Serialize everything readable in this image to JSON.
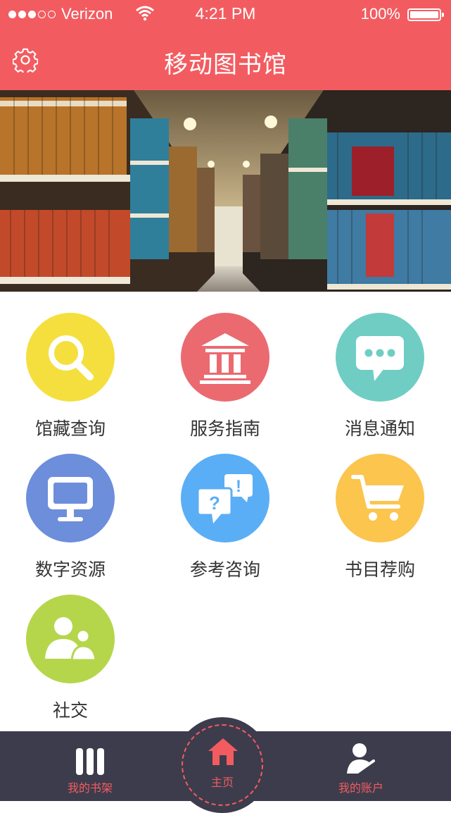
{
  "status_bar": {
    "carrier": "Verizon",
    "time": "4:21 PM",
    "battery": "100%",
    "signal_icon": "signal-dots-icon",
    "wifi_icon": "wifi-icon",
    "battery_icon": "battery-icon"
  },
  "nav": {
    "title": "移动图书馆",
    "settings_icon": "gear-icon"
  },
  "banner": {
    "image": "library-bookshelves-photo"
  },
  "menu": [
    {
      "label": "馆藏查询",
      "icon": "search-icon",
      "color": "#f5df3e"
    },
    {
      "label": "服务指南",
      "icon": "library-building-icon",
      "color": "#ea6a70"
    },
    {
      "label": "消息通知",
      "icon": "message-bubble-icon",
      "color": "#6fcdc4"
    },
    {
      "label": "数字资源",
      "icon": "monitor-icon",
      "color": "#6d8edb"
    },
    {
      "label": "参考咨询",
      "icon": "consult-bubbles-icon",
      "color": "#5aaef5"
    },
    {
      "label": "书目荐购",
      "icon": "shopping-cart-icon",
      "color": "#fbc54e"
    },
    {
      "label": "社交",
      "icon": "people-icon",
      "color": "#b5d64b"
    }
  ],
  "tab_bar": {
    "tabs": [
      {
        "label": "我的书架",
        "icon": "bookshelf-icon"
      },
      {
        "label": "主页",
        "icon": "home-icon"
      },
      {
        "label": "我的账户",
        "icon": "account-icon"
      }
    ],
    "accent": "#f25c60",
    "background": "#3d3c4c"
  }
}
